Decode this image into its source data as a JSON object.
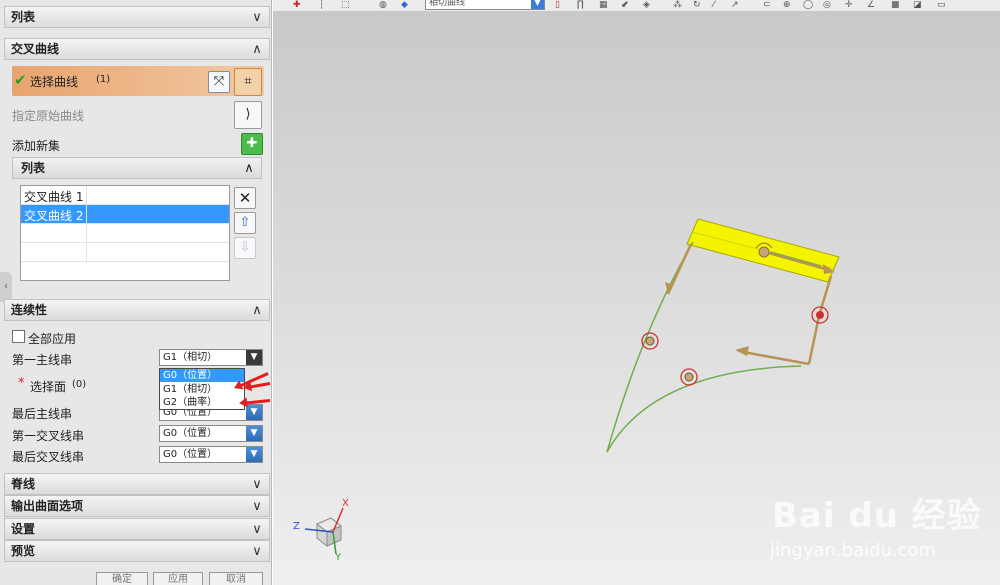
{
  "panel": {
    "top_list_header": "列表",
    "intersect_section": {
      "title": "交叉曲线",
      "select_curve_label": "选择曲线",
      "select_curve_count": "(1)",
      "specify_origin_label": "指定原始曲线",
      "add_new_set_label": "添加新集",
      "list_header": "列表",
      "list_items": [
        "交叉曲线 1",
        "交叉曲线 2"
      ],
      "selected_index": 1
    },
    "continuity_section": {
      "title": "连续性",
      "apply_all_label": "全部应用",
      "first_primary_label": "第一主线串",
      "first_primary_value": "G1（相切）",
      "select_face_label": "选择面",
      "select_face_count": "(0)",
      "last_primary_label": "最后主线串",
      "last_primary_value": "G0（位置）",
      "first_cross_label": "第一交叉线串",
      "first_cross_value": "G0（位置）",
      "last_cross_label": "最后交叉线串",
      "last_cross_value": "G0（位置）",
      "dropdown_options": [
        "G0（位置）",
        "G1（相切）",
        "G2（曲率）"
      ],
      "dropdown_highlight_index": 0
    },
    "collapsed_sections": [
      "脊线",
      "输出曲面选项",
      "设置",
      "预览"
    ],
    "bottom_buttons": [
      "确定",
      "应用",
      "取消"
    ]
  },
  "toolbar": {
    "combo_value": "相切曲线"
  },
  "viewport": {
    "axis_labels": {
      "x": "X",
      "y": "Y",
      "z": "Z"
    },
    "watermark_logo": "Bai du 经验",
    "watermark_url": "jingyan.baidu.com"
  },
  "colors": {
    "selected_blue": "#3399ff",
    "highlight_orange": "#e8a46f",
    "surface_yellow": "#f4f400",
    "curve_green": "#6fae4f",
    "arrow_tan": "#b89454",
    "annotation_red": "#e02020"
  }
}
